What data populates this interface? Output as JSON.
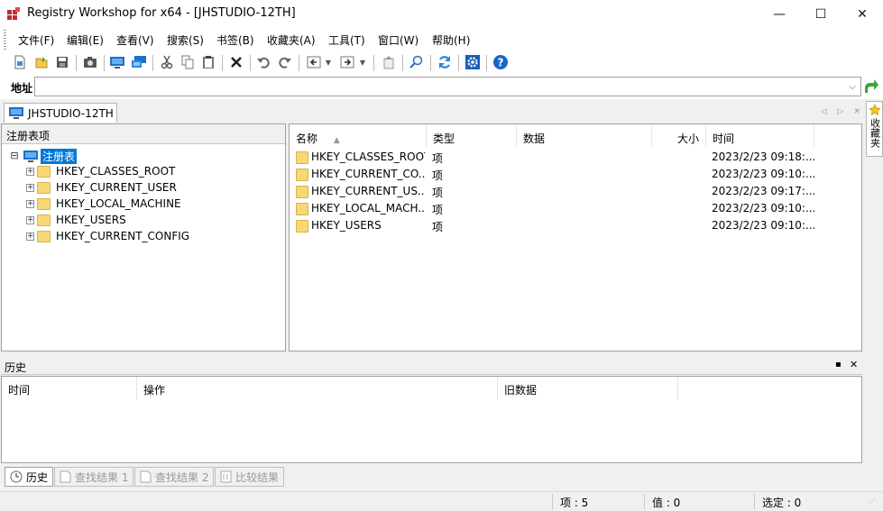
{
  "window": {
    "title": "Registry Workshop for x64 - [JHSTUDIO-12TH]",
    "controls": {
      "minimize": "—",
      "maximize": "☐",
      "close": "✕"
    }
  },
  "menu": [
    "文件(F)",
    "编辑(E)",
    "查看(V)",
    "搜索(S)",
    "书签(B)",
    "收藏夹(A)",
    "工具(T)",
    "窗口(W)",
    "帮助(H)"
  ],
  "toolbar_icons": [
    "new-key-icon",
    "import-icon",
    "save-icon",
    "snapshot-icon",
    "local-computer-icon",
    "remote-computer-icon",
    "cut-icon",
    "copy-icon",
    "paste-icon",
    "delete-icon",
    "undo-icon",
    "redo-icon",
    "back-icon",
    "forward-icon",
    "up-level-icon",
    "find-icon",
    "refresh-icon",
    "options-icon",
    "help-icon"
  ],
  "address": {
    "label": "地址",
    "value": ""
  },
  "doc_tab": {
    "label": "JHSTUDIO-12TH"
  },
  "favorites_tab": {
    "label": "收藏夹"
  },
  "tree": {
    "header": "注册表项",
    "root": "注册表",
    "expand_root": "⊟",
    "expand_child": "+",
    "children": [
      "HKEY_CLASSES_ROOT",
      "HKEY_CURRENT_USER",
      "HKEY_LOCAL_MACHINE",
      "HKEY_USERS",
      "HKEY_CURRENT_CONFIG"
    ]
  },
  "list": {
    "columns": {
      "name": "名称",
      "type": "类型",
      "data": "数据",
      "size": "大小",
      "time": "时间"
    },
    "sort_indicator": "▲",
    "rows": [
      {
        "name": "HKEY_CLASSES_ROOT",
        "type": "项",
        "time": "2023/2/23 09:18:..."
      },
      {
        "name": "HKEY_CURRENT_CO...",
        "type": "项",
        "time": "2023/2/23 09:10:..."
      },
      {
        "name": "HKEY_CURRENT_US...",
        "type": "项",
        "time": "2023/2/23 09:17:..."
      },
      {
        "name": "HKEY_LOCAL_MACH...",
        "type": "项",
        "time": "2023/2/23 09:10:..."
      },
      {
        "name": "HKEY_USERS",
        "type": "项",
        "time": "2023/2/23 09:10:..."
      }
    ]
  },
  "history": {
    "title": "历史",
    "pin": "▪",
    "close": "✕",
    "columns": {
      "time": "时间",
      "action": "操作",
      "old_data": "旧数据"
    }
  },
  "bottom_tabs": [
    "历史",
    "查找结果 1",
    "查找结果 2",
    "比较结果"
  ],
  "status": {
    "items": "项 : 5",
    "values": "值 : 0",
    "selected": "选定 : 0"
  },
  "colors": {
    "selection": "#0078d7",
    "folder": "#f8d775",
    "help": "#1a64c8",
    "refresh": "#2a88d8",
    "go": "#3aa53a"
  }
}
